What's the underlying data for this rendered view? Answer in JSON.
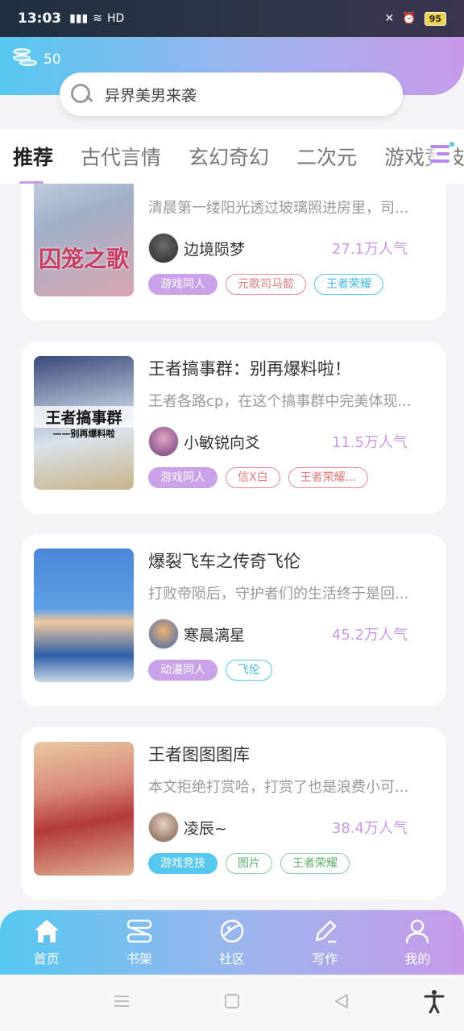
{
  "status_bar": {
    "time": "13:03",
    "network": "HD",
    "battery": "95"
  },
  "header": {
    "coins": "50",
    "search_placeholder": "异界美男来袭"
  },
  "tabs": [
    "推荐",
    "古代言情",
    "玄幻奇幻",
    "二次元",
    "游戏竞技"
  ],
  "cards": [
    {
      "title": "",
      "desc": "清晨第一缕阳光透过玻璃照进房里，司...",
      "author": "边境陨梦",
      "popularity": "27.1万人气",
      "cover_text": "囚笼之歌",
      "tags": [
        {
          "label": "游戏同人",
          "style": "fill-purple"
        },
        {
          "label": "元歌司马懿",
          "style": "red"
        },
        {
          "label": "王者荣耀",
          "style": "cyan"
        }
      ]
    },
    {
      "title": "王者搞事群：别再爆料啦！",
      "desc": "王者各路cp，在这个搞事群中完美体现...",
      "author": "小敏锐向爻",
      "popularity": "11.5万人气",
      "cover_text": "王者搞事群",
      "cover_sub": "——别再爆料啦",
      "tags": [
        {
          "label": "游戏同人",
          "style": "fill-purple"
        },
        {
          "label": "信X白",
          "style": "red"
        },
        {
          "label": "王者荣耀...",
          "style": "red"
        }
      ]
    },
    {
      "title": "爆裂飞车之传奇飞伦",
      "desc": "打败帝陨后，守护者们的生活终于是回...",
      "author": "寒晨漓星",
      "popularity": "45.2万人气",
      "tags": [
        {
          "label": "动漫同人",
          "style": "fill-purple"
        },
        {
          "label": "飞伦",
          "style": "cyan"
        }
      ]
    },
    {
      "title": "王者图图图库",
      "desc": "本文拒绝打赏哈，打赏了也是浪费小可...",
      "author": "凌辰~",
      "popularity": "38.4万人气",
      "tags": [
        {
          "label": "游戏竞技",
          "style": "fill-blue"
        },
        {
          "label": "图片",
          "style": "green"
        },
        {
          "label": "王者荣耀",
          "style": "green"
        }
      ]
    }
  ],
  "bottom_nav": [
    {
      "label": "首页",
      "icon": "home-icon"
    },
    {
      "label": "书架",
      "icon": "bookshelf-icon"
    },
    {
      "label": "社区",
      "icon": "planet-icon"
    },
    {
      "label": "写作",
      "icon": "pen-icon"
    },
    {
      "label": "我的",
      "icon": "profile-icon"
    }
  ],
  "colors": {
    "accent_blue": "#56c8f0",
    "accent_purple": "#c79ae9"
  }
}
